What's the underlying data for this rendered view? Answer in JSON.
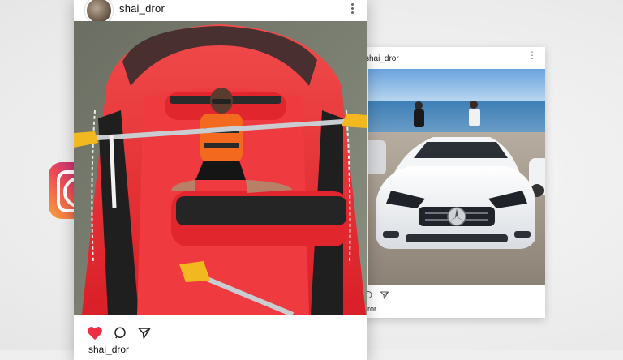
{
  "post_front": {
    "username": "shai_dror",
    "caption_username": "shai_dror",
    "icons": {
      "like": "heart-filled-icon",
      "comment": "comment-icon",
      "share": "send-icon",
      "more": "more-vertical-icon"
    },
    "colors": {
      "like": "#ed2f46"
    }
  },
  "post_back": {
    "username": "shai_dror",
    "caption_username": "dror",
    "icons": {
      "comment": "comment-icon",
      "share": "send-icon",
      "more": "more-vertical-icon"
    }
  },
  "brand": {
    "logo": "instagram-logo-icon"
  }
}
